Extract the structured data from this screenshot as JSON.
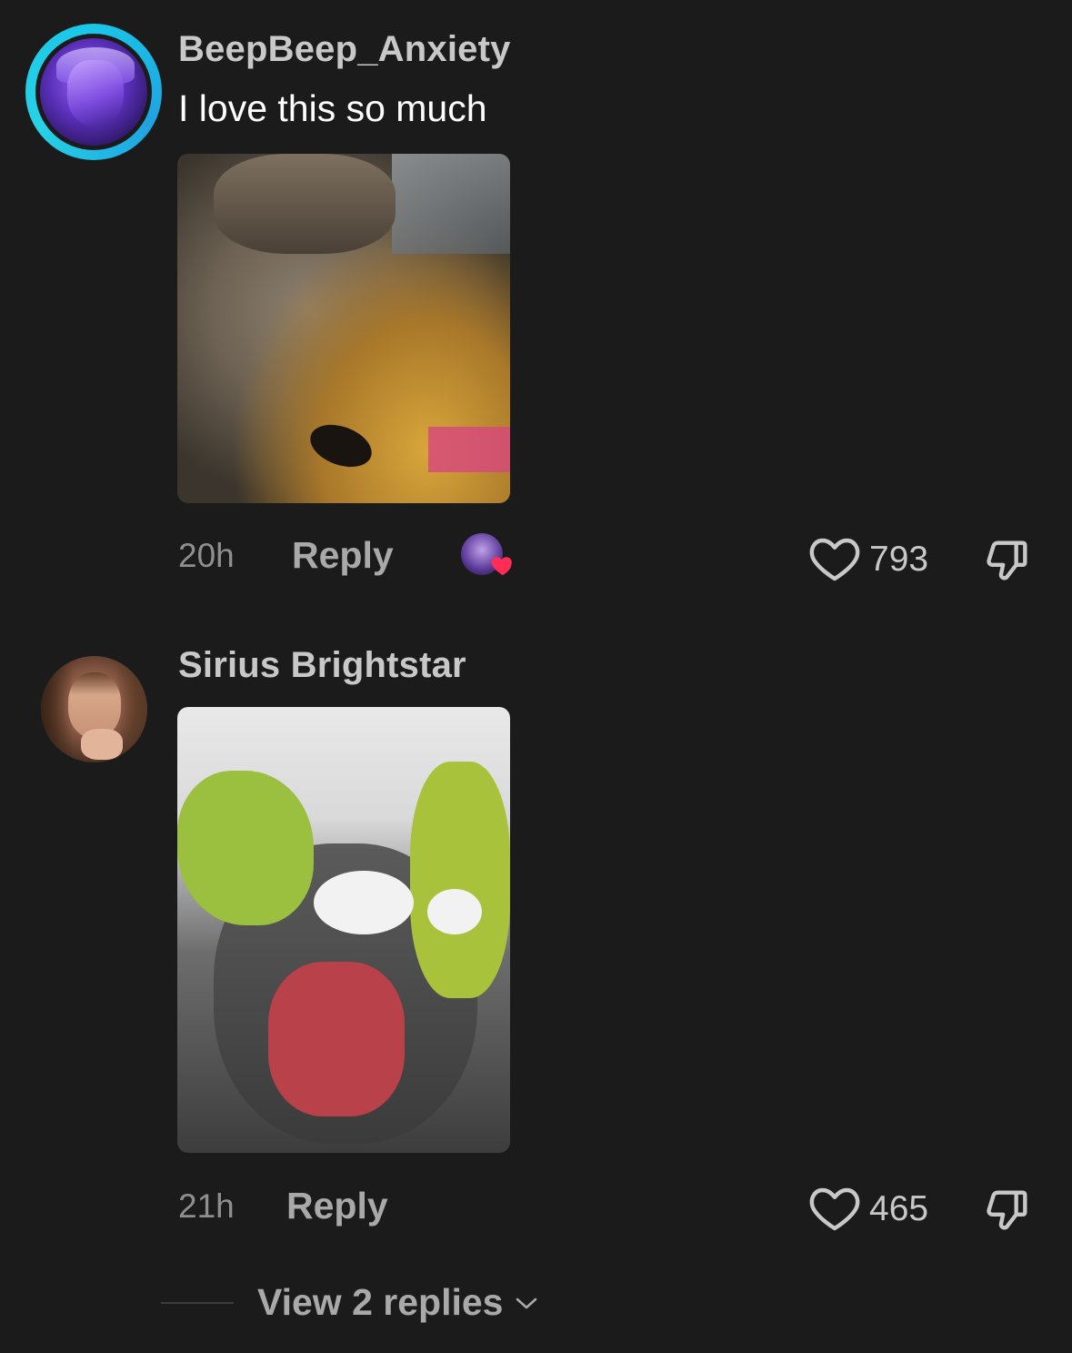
{
  "comments": [
    {
      "username": "BeepBeep_Anxiety",
      "text": "I love this so much",
      "media": "cat-image",
      "time": "20h",
      "reply_label": "Reply",
      "likes": "793",
      "creator_liked": true
    },
    {
      "username": "Sirius Brightstar",
      "text": "",
      "media": "cartoon-dragon-image",
      "time": "21h",
      "reply_label": "Reply",
      "likes": "465"
    }
  ],
  "view_replies": "View 2 replies",
  "colors": {
    "background": "#1b1b1c",
    "avatar_ring": "#19c6e8",
    "heart_badge": "#ff2d55"
  },
  "icons": [
    "heart-outline-icon",
    "thumbs-down-icon",
    "chevron-down-icon"
  ]
}
